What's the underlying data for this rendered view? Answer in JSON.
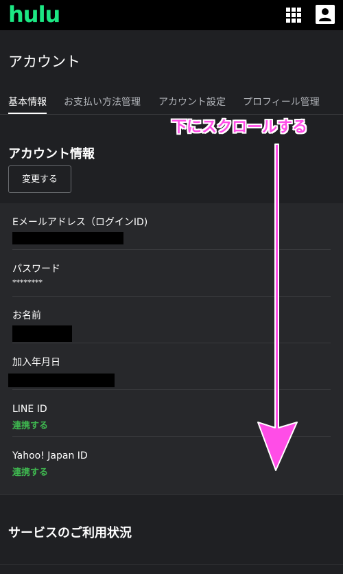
{
  "topbar": {
    "logo": "hulu",
    "grid_icon": "grid-icon",
    "user_icon": "user-icon"
  },
  "page": {
    "title": "アカウント"
  },
  "tabs": [
    {
      "label": "基本情報",
      "active": true
    },
    {
      "label": "お支払い方法管理",
      "active": false
    },
    {
      "label": "アカウント設定",
      "active": false
    },
    {
      "label": "プロフィール管理",
      "active": false
    }
  ],
  "account": {
    "section_title": "アカウント情報",
    "change_button": "変更する",
    "rows": [
      {
        "label": "Eメールアドレス（ログインID)",
        "value": "",
        "redacted": true
      },
      {
        "label": "パスワード",
        "value": "********",
        "redacted": false
      },
      {
        "label": "お名前",
        "value": "",
        "redacted": true
      },
      {
        "label": "加入年月日",
        "value": "",
        "redacted": true
      },
      {
        "label": "LINE ID",
        "link": "連携する"
      },
      {
        "label": "Yahoo! Japan ID",
        "link": "連携する"
      }
    ]
  },
  "services": {
    "title": "サービスのご利用状況"
  },
  "annotation": {
    "text": "下にスクロールする",
    "color": "#ff4de7"
  },
  "colors": {
    "brand": "#1ce783",
    "link": "#3fb950",
    "background": "#1f2023",
    "panel": "#27282b"
  }
}
